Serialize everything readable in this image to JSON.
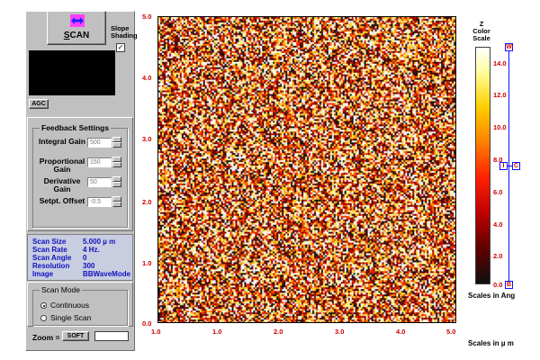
{
  "toolbar": {
    "scan_label": "SCAN",
    "scan_mnemonic_tail": "CAN",
    "slope_shading_label": "Slope Shading",
    "slope_shading_checked": true
  },
  "agc_label": "AGC",
  "feedback": {
    "title": "Feedback Settings",
    "rows": [
      {
        "label": "Integral Gain",
        "value": "500"
      },
      {
        "label": "Proportional Gain",
        "value": "150"
      },
      {
        "label": "Derivative Gain",
        "value": "50"
      },
      {
        "label": "Setpt. Offset",
        "value": "-0.5"
      }
    ]
  },
  "info": [
    {
      "key": "Scan Size",
      "value": "5.000 µ m"
    },
    {
      "key": "Scan Rate",
      "value": "4 Hz."
    },
    {
      "key": "Scan Angle",
      "value": "0"
    },
    {
      "key": "Resolution",
      "value": "300"
    },
    {
      "key": "Image",
      "value": "BBWaveMode"
    }
  ],
  "scan_mode": {
    "title": "Scan Mode",
    "options": [
      {
        "label": "Continuous",
        "selected": true
      },
      {
        "label": "Single Scan",
        "selected": false
      }
    ]
  },
  "zoom": {
    "label": "Zoom =",
    "soft_label": "SOFT",
    "value": ""
  },
  "plot": {
    "x_ticks": [
      "1.0",
      "1.0",
      "2.0",
      "3.0",
      "4.0",
      "5.0"
    ],
    "y_ticks": [
      "5.0",
      "4.0",
      "3.0",
      "2.0",
      "1.0",
      "0.0"
    ],
    "x_units": "Scales in µ m"
  },
  "zscale": {
    "title": "Z Color Scale",
    "ticks": [
      "14.0",
      "12.0",
      "10.0",
      "8.0",
      "6.0",
      "4.0",
      "2.0",
      "0.0"
    ],
    "units": "Scales in Ang",
    "markers": {
      "top": "W",
      "mid_left": "I",
      "mid_right": "C",
      "bottom": "B"
    }
  },
  "colors": {
    "panel": "#c0c0c0",
    "info_text": "#1010c0",
    "tick_text": "#cc0000",
    "slider": "#1010ff"
  }
}
